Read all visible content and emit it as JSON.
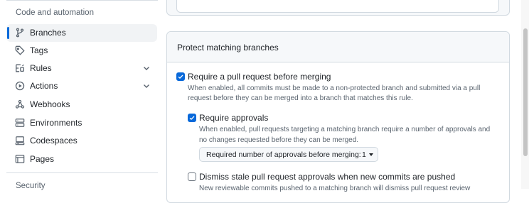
{
  "sidebar": {
    "section_heading": "Code and automation",
    "items": [
      {
        "label": "Branches",
        "icon": "git-branch-icon",
        "active": true
      },
      {
        "label": "Tags",
        "icon": "tag-icon"
      },
      {
        "label": "Rules",
        "icon": "rules-icon",
        "expandable": true
      },
      {
        "label": "Actions",
        "icon": "play-icon",
        "expandable": true
      },
      {
        "label": "Webhooks",
        "icon": "webhook-icon"
      },
      {
        "label": "Environments",
        "icon": "server-icon"
      },
      {
        "label": "Codespaces",
        "icon": "codespaces-icon"
      },
      {
        "label": "Pages",
        "icon": "browser-icon"
      }
    ],
    "next_section_heading": "Security"
  },
  "panel": {
    "title": "Protect matching branches",
    "require_pr": {
      "label": "Require a pull request before merging",
      "checked": true,
      "description_line1": "When enabled, all commits must be made to a non-protected branch and submitted via a pull",
      "description_line2": "request before they can be merged into a branch that matches this rule."
    },
    "require_approvals": {
      "label": "Require approvals",
      "checked": true,
      "description_line1": "When enabled, pull requests targeting a matching branch require a number of approvals and",
      "description_line2": "no changes requested before they can be merged.",
      "select_label": "Required number of approvals before merging:",
      "select_value": "1"
    },
    "dismiss_stale": {
      "label": "Dismiss stale pull request approvals when new commits are pushed",
      "checked": false,
      "description_line1": "New reviewable commits pushed to a matching branch will dismiss pull request review"
    }
  },
  "colors": {
    "accent": "#0969da",
    "border": "#d1d9e0",
    "muted_text": "#59636e",
    "header_bg": "#f6f8fa"
  }
}
